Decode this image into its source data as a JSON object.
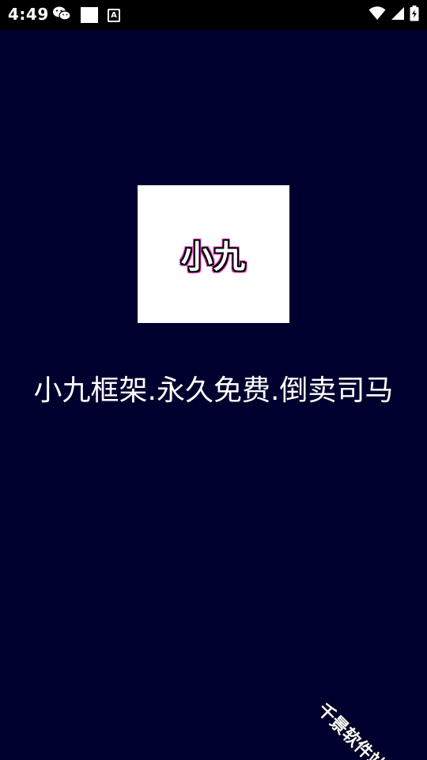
{
  "status_bar": {
    "time": "4:49",
    "left_icons": [
      "wechat-icon",
      "square-notification-icon",
      "a-keyboard-icon"
    ],
    "right_icons": [
      "wifi-icon",
      "cell-signal-icon",
      "battery-charging-icon"
    ],
    "a_icon_glyph": "A"
  },
  "logo": {
    "text": "小九"
  },
  "slogan": "小九框架.永久免费.倒卖司马",
  "watermark": "千景软件站",
  "colors": {
    "background": "#00002e",
    "status_bar": "#000000",
    "logo_box": "#ffffff",
    "logo_outline": "#ff4fd8",
    "text": "#ffffff"
  }
}
